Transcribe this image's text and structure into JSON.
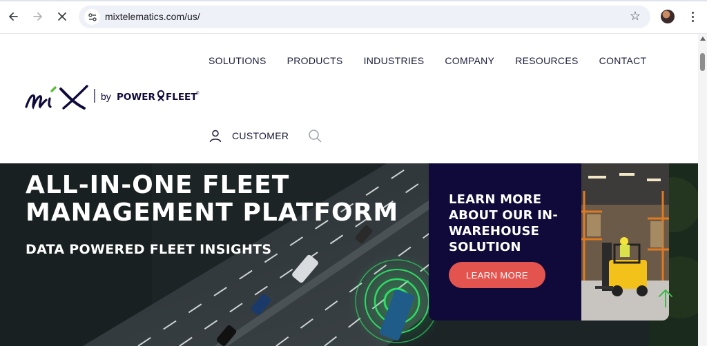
{
  "browser": {
    "url": "mixtelematics.com/us/",
    "icons": {
      "back": "back-arrow-icon",
      "forward": "forward-arrow-icon",
      "stop": "stop-loading-icon",
      "site_info": "site-settings-icon",
      "bookmark": "star-icon",
      "menu": "kebab-menu-icon"
    }
  },
  "header": {
    "logo_by": "by",
    "logo_brand_left": "POWER",
    "logo_brand_right": "FLEET",
    "logo_mark": "mix",
    "nav": [
      "SOLUTIONS",
      "PRODUCTS",
      "INDUSTRIES",
      "COMPANY",
      "RESOURCES",
      "CONTACT"
    ],
    "customer_label": "CUSTOMER"
  },
  "hero": {
    "title_line1": "ALL-IN-ONE FLEET",
    "title_line2": "MANAGEMENT PLATFORM",
    "subtitle": "DATA POWERED FLEET INSIGHTS",
    "promo": {
      "text": "LEARN MORE ABOUT OUR IN-WAREHOUSE SOLUTION",
      "button_label": "LEARN MORE"
    }
  },
  "colors": {
    "brand_navy": "#0f0a3a",
    "brand_green": "#5bbf3b",
    "cta_red": "#e4544f",
    "nav_text": "#1a1a3a"
  }
}
